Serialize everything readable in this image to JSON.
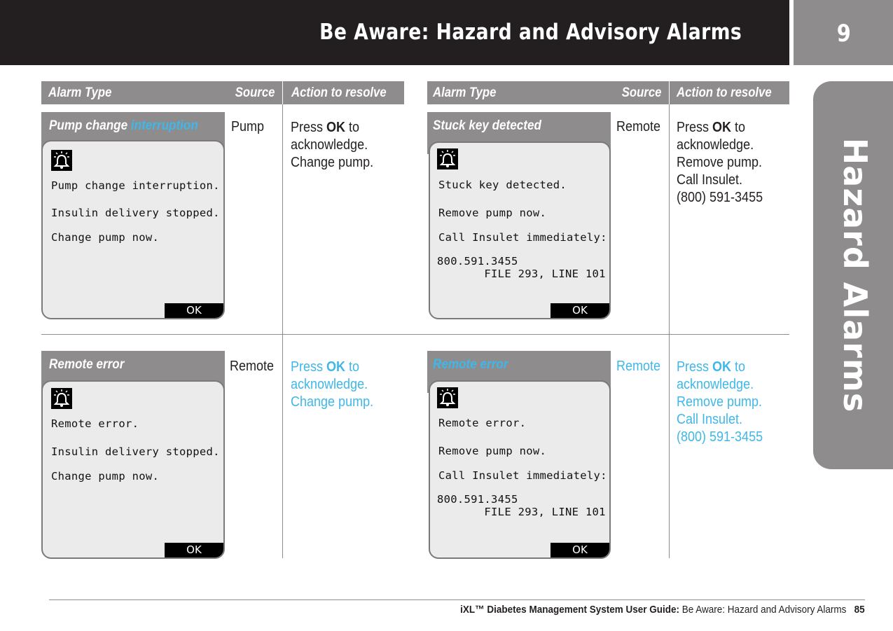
{
  "header": {
    "title": "Be Aware: Hazard and Advisory Alarms",
    "chapter_number": "9"
  },
  "side_tab": {
    "label": "Hazard Alarms"
  },
  "table_headers": {
    "alarm_type": "Alarm Type",
    "source": "Source",
    "action": "Action to resolve"
  },
  "alarms": [
    {
      "title_main": "Pump change ",
      "title_highlight": "interruption",
      "screen_lines": [
        "Pump change interruption.",
        "Insulin delivery stopped.",
        "Change pump now."
      ],
      "ok_label": "OK",
      "source": "Pump",
      "action_prefix": "Press ",
      "action_bold": "OK",
      "action_suffix": " to",
      "action_lines": [
        "acknowledge.",
        "Change pump."
      ]
    },
    {
      "title_main": "Stuck key detected",
      "title_highlight": "",
      "screen_lines": [
        "Stuck key detected.",
        "Remove pump now.",
        "Call Insulet immediately:",
        "800.591.3455",
        "       FILE 293, LINE 101"
      ],
      "ok_label": "OK",
      "source": "Remote",
      "action_prefix": "Press ",
      "action_bold": "OK",
      "action_suffix": " to",
      "action_lines": [
        "acknowledge.",
        "Remove pump.",
        "Call Insulet.",
        "(800) 591-3455"
      ]
    },
    {
      "title_main": "Remote error",
      "title_highlight": "",
      "screen_lines": [
        "Remote error.",
        "Insulin delivery stopped.",
        "Change pump now."
      ],
      "ok_label": "OK",
      "source": "Remote",
      "action_prefix": "Press ",
      "action_bold": "OK",
      "action_suffix": " to",
      "action_lines": [
        "acknowledge.",
        "Change pump."
      ]
    },
    {
      "title_main": "",
      "title_highlight": "Remote error",
      "screen_lines": [
        "Remote error.",
        "Remove pump now.",
        "Call Insulet immediately:",
        "800.591.3455",
        "       FILE 293, LINE 101"
      ],
      "ok_label": "OK",
      "source": "Remote",
      "action_prefix": "Press ",
      "action_bold": "OK",
      "action_suffix": " to",
      "action_lines": [
        "acknowledge.",
        "Remove pump.",
        "Call Insulet.",
        "(800) 591-3455"
      ]
    }
  ],
  "footer": {
    "guide_label": "iXL™ Diabetes Management System User Guide:",
    "section": " Be Aware: Hazard and Advisory Alarms",
    "page_number": "85"
  },
  "colors": {
    "header_bg": "#231f20",
    "gray": "#8e8c8d",
    "highlight_blue": "#3fb7e9"
  }
}
